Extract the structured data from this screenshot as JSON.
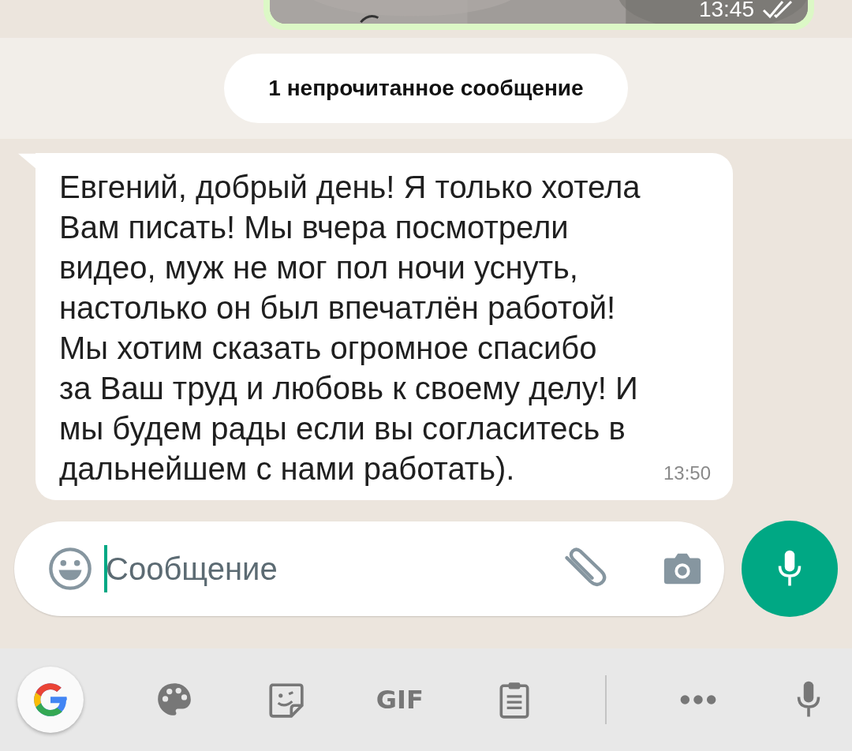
{
  "sent_photo": {
    "time": "13:45",
    "read": true
  },
  "unread_banner": "1 непрочитанное сообщение",
  "incoming_message": {
    "text": "Евгений, добрый день! Я только хотела\nВам писать! Мы вчера посмотрели\nвидео, муж не мог пол ночи уснуть,\nнастолько он был впечатлён работой!\nМы хотим сказать огромное спасибо\nза Ваш труд и любовь к своему делу! И\nмы будем рады если вы согласитесь в\nдальнейшем с нами работать).",
    "time": "13:50"
  },
  "composer": {
    "placeholder": "Сообщение"
  },
  "keyboard_toolbar": [
    {
      "kind": "google"
    },
    {
      "kind": "palette"
    },
    {
      "kind": "sticker"
    },
    {
      "kind": "gif",
      "label": "GIF"
    },
    {
      "kind": "clipboard"
    },
    {
      "kind": "divider"
    },
    {
      "kind": "more"
    },
    {
      "kind": "mic"
    }
  ]
}
